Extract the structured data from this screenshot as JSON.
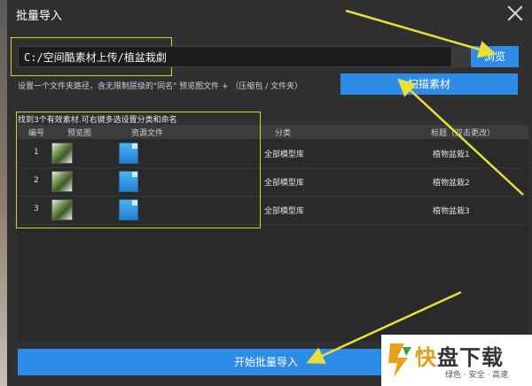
{
  "window": {
    "title": "批量导入"
  },
  "path": {
    "value": "C:/空间酷素材上传/植盆栽劇"
  },
  "buttons": {
    "browse": "浏览",
    "scan": "扫描素材",
    "start": "开始批量导入"
  },
  "hint": "设置一个文件夹路径，含无限制层级的\"同名\" 预览图文件 + （压缩包 / 文件夹）",
  "found": "找到3个有效素材.可右键多选设置分类和命名",
  "table": {
    "headers": {
      "num": "编号",
      "preview": "预览图",
      "file": "资源文件",
      "category": "分类",
      "title": "标题（双击更改）"
    },
    "rows": [
      {
        "num": "1",
        "category": "全部模型库",
        "title": "植物盆栽1"
      },
      {
        "num": "2",
        "category": "全部模型库",
        "title": "植物盆栽2"
      },
      {
        "num": "3",
        "category": "全部模型库",
        "title": "植物盆栽3"
      }
    ]
  },
  "watermark": {
    "big1": "快",
    "big2": "盘下载",
    "sub": "绿色 · 安全 · 高速"
  },
  "icons": {
    "close": "close-icon",
    "file": "archive-file-icon",
    "thumb": "plant-thumbnail"
  },
  "colors": {
    "accent": "#2f8be8",
    "highlight": "#d6cf3a",
    "arrow": "#e8e03a"
  }
}
